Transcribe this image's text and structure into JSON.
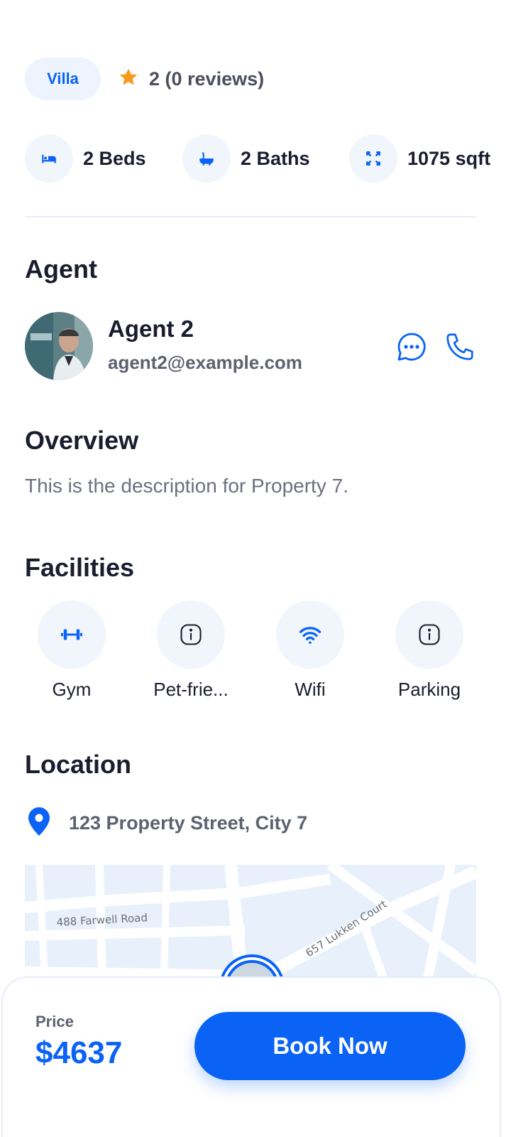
{
  "property": {
    "type": "Villa",
    "rating_text": "2 (0 reviews)",
    "beds": "2 Beds",
    "baths": "2 Baths",
    "area": "1075 sqft"
  },
  "agent": {
    "section_title": "Agent",
    "name": "Agent 2",
    "email": "agent2@example.com"
  },
  "overview": {
    "section_title": "Overview",
    "description": "This is the description for Property 7."
  },
  "facilities": {
    "section_title": "Facilities",
    "items": [
      {
        "label": "Gym",
        "icon": "dumbbell-icon"
      },
      {
        "label": "Pet-frie...",
        "icon": "info-icon"
      },
      {
        "label": "Wifi",
        "icon": "wifi-icon"
      },
      {
        "label": "Parking",
        "icon": "info-icon"
      }
    ]
  },
  "location": {
    "section_title": "Location",
    "address": "123 Property Street, City 7",
    "map_labels": [
      "488 Farwell Road",
      "657 Lukken Court"
    ]
  },
  "booking": {
    "price_label": "Price",
    "price": "$4637",
    "button_label": "Book Now"
  },
  "colors": {
    "accent": "#0a63f5",
    "star": "#f79a1e",
    "chip_bg": "#eef4fd"
  }
}
